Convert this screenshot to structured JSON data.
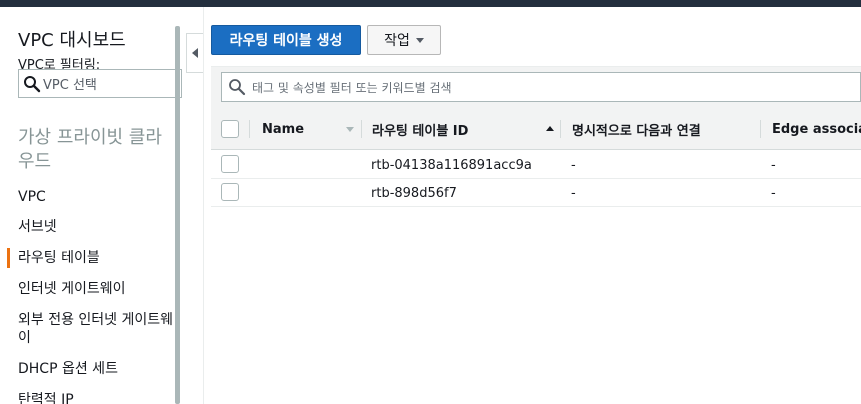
{
  "sidebar": {
    "title": "VPC 대시보드",
    "filter_label": "VPC로 필터링:",
    "select_placeholder": "VPC 선택",
    "section_title": "가상 프라이빗 클라우드",
    "items": [
      {
        "label": "VPC",
        "active": false
      },
      {
        "label": "서브넷",
        "active": false
      },
      {
        "label": "라우팅 테이블",
        "active": true
      },
      {
        "label": "인터넷 게이트웨이",
        "active": false
      },
      {
        "label": "외부 전용 인터넷 게이트웨이",
        "active": false
      },
      {
        "label": "DHCP 옵션 세트",
        "active": false
      },
      {
        "label": "탄력적 IP",
        "active": false
      }
    ]
  },
  "toolbar": {
    "create_label": "라우팅 테이블 생성",
    "actions_label": "작업"
  },
  "search": {
    "placeholder": "태그 및 속성별 필터 또는 키워드별 검색"
  },
  "table": {
    "columns": [
      "Name",
      "라우팅 테이블 ID",
      "명시적으로 다음과 연결",
      "Edge associa"
    ],
    "rows": [
      {
        "name": "",
        "id": "rtb-04138a116891acc9a",
        "explicit": "-",
        "edge": "-"
      },
      {
        "name": "",
        "id": "rtb-898d56f7",
        "explicit": "-",
        "edge": "-"
      }
    ]
  },
  "colors": {
    "primary": "#1b6ec2",
    "active_marker": "#ec7211",
    "topbar": "#232f3e"
  }
}
